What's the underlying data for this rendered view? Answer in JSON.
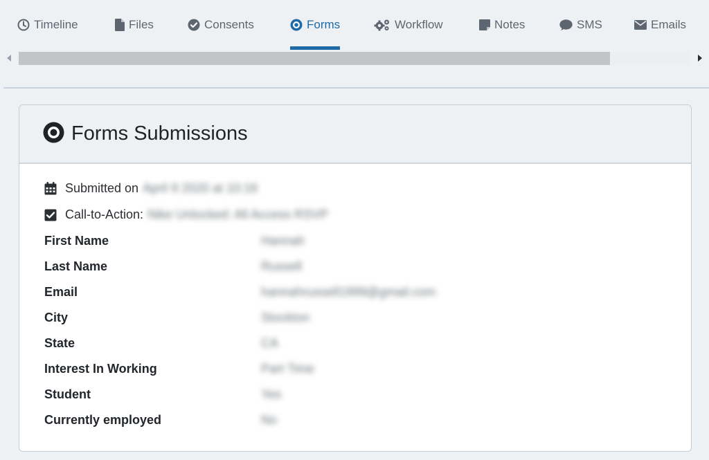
{
  "colors": {
    "accent": "#1e6aa8",
    "tab_text": "#5d6670",
    "background": "#eef1f4",
    "card_background": "#ffffff"
  },
  "tabs": [
    {
      "label": "Timeline",
      "icon": "clock-icon",
      "active": false
    },
    {
      "label": "Files",
      "icon": "file-icon",
      "active": false
    },
    {
      "label": "Consents",
      "icon": "check-circle-icon",
      "active": false
    },
    {
      "label": "Forms",
      "icon": "dot-circle-icon",
      "active": true
    },
    {
      "label": "Workflow",
      "icon": "gears-icon",
      "active": false
    },
    {
      "label": "Notes",
      "icon": "sticky-note-icon",
      "active": false
    },
    {
      "label": "SMS",
      "icon": "chat-bubble-icon",
      "active": false
    },
    {
      "label": "Emails",
      "icon": "envelope-icon",
      "active": false
    }
  ],
  "card": {
    "title": "Forms Submissions",
    "title_icon": "dot-circle-icon",
    "submitted_label": "Submitted on",
    "submitted_value": "April 9 2020 at 10:16",
    "cta_label": "Call-to-Action:",
    "cta_value": "Nike Unlocked: All Access RSVP",
    "fields": [
      {
        "label": "First Name",
        "value": "Hannah"
      },
      {
        "label": "Last Name",
        "value": "Russell"
      },
      {
        "label": "Email",
        "value": "hannahrussell1999@gmail.com"
      },
      {
        "label": "City",
        "value": "Stockton"
      },
      {
        "label": "State",
        "value": "CA"
      },
      {
        "label": "Interest In Working",
        "value": "Part Time"
      },
      {
        "label": "Student",
        "value": "Yes"
      },
      {
        "label": "Currently employed",
        "value": "No"
      }
    ]
  }
}
